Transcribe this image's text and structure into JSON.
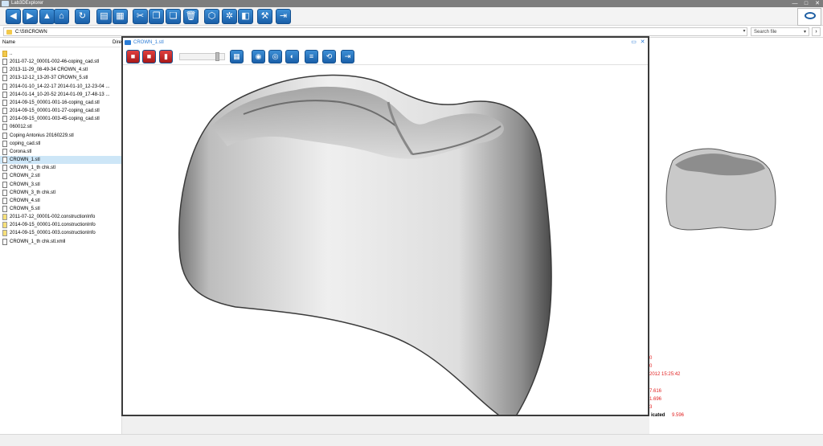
{
  "app": {
    "title": "Lab3DExplorer"
  },
  "window_controls": [
    "—",
    "□",
    "✕"
  ],
  "toolbar": {
    "buttons": [
      {
        "name": "back-button",
        "glyph": "◀"
      },
      {
        "name": "forward-button",
        "glyph": "▶"
      },
      {
        "name": "up-button",
        "glyph": "▲"
      },
      {
        "name": "home-button",
        "glyph": "⌂"
      },
      {
        "name": "refresh-button",
        "glyph": "↻"
      },
      {
        "name": "view-details-button",
        "glyph": "▤"
      },
      {
        "name": "view-grid-button",
        "glyph": "▦"
      },
      {
        "name": "cut-button",
        "glyph": "✂"
      },
      {
        "name": "copy-button",
        "glyph": "❐"
      },
      {
        "name": "paste-button",
        "glyph": "❏"
      },
      {
        "name": "delete-button",
        "glyph": "🗑"
      },
      {
        "name": "3d-view-button",
        "glyph": "⬡"
      },
      {
        "name": "tools-button",
        "glyph": "✲"
      },
      {
        "name": "cube-button",
        "glyph": "◧"
      },
      {
        "name": "settings-button",
        "glyph": "⚒"
      },
      {
        "name": "exit-button",
        "glyph": "⇥"
      }
    ]
  },
  "address": {
    "path": "C:\\Stl\\CROWN",
    "dropdown": "▾"
  },
  "search": {
    "placeholder": "Search file",
    "dropdown": "▾",
    "button": "›"
  },
  "filepanel": {
    "col_name": "Name",
    "col_dir": "Dire",
    "files": [
      {
        "name": "..",
        "type": "folder"
      },
      {
        "name": "2011-07-12_00001-002-46-coping_cad.stl",
        "type": "stl"
      },
      {
        "name": "2013-11-29_08-49-34 CROWN_4.stl",
        "type": "stl"
      },
      {
        "name": "2013-12-12_13-20-37 CROWN_5.stl",
        "type": "stl"
      },
      {
        "name": "2014-01-10_14-22-17 2014-01-10_12-23-04 ...",
        "type": "stl"
      },
      {
        "name": "2014-01-14_10-20-52 2014-01-09_17-48-13 ...",
        "type": "stl"
      },
      {
        "name": "2014-09-15_00001-001-16-coping_cad.stl",
        "type": "stl"
      },
      {
        "name": "2014-09-15_00001-001-27-coping_cad.stl",
        "type": "stl"
      },
      {
        "name": "2014-09-15_00001-003-45-coping_cad.stl",
        "type": "stl"
      },
      {
        "name": "060012.stl",
        "type": "stl"
      },
      {
        "name": "Coping Antonius 20160229.stl",
        "type": "stl"
      },
      {
        "name": "coping_cad.stl",
        "type": "stl"
      },
      {
        "name": "Corona.stl",
        "type": "stl"
      },
      {
        "name": "CROWN_1.stl",
        "type": "stl",
        "selected": true
      },
      {
        "name": "CROWN_1_th chk.stl",
        "type": "stl"
      },
      {
        "name": "CROWN_2.stl",
        "type": "stl"
      },
      {
        "name": "CROWN_3.stl",
        "type": "stl"
      },
      {
        "name": "CROWN_3_th chk.stl",
        "type": "stl"
      },
      {
        "name": "CROWN_4.stl",
        "type": "stl"
      },
      {
        "name": "CROWN_5.stl",
        "type": "stl"
      },
      {
        "name": "2011-07-12_00001-002.constructionInfo",
        "type": "info"
      },
      {
        "name": "2014-09-15_00001-001.constructionInfo",
        "type": "info"
      },
      {
        "name": "2014-09-15_00001-003.constructionInfo",
        "type": "info"
      },
      {
        "name": "CROWN_1_th chk.stl.xmll",
        "type": "doc"
      }
    ]
  },
  "viewer": {
    "title": "CROWN_1.stl",
    "controls": [
      "▭",
      "✕"
    ],
    "slider_value": 0.85,
    "toolbar": [
      {
        "name": "color-red-button",
        "glyph": "■",
        "red": true
      },
      {
        "name": "color-dark-button",
        "glyph": "■",
        "red": true
      },
      {
        "name": "color-side-button",
        "glyph": "▮",
        "red": true
      },
      {
        "name": "grid-button",
        "glyph": "▦"
      },
      {
        "name": "top-view-button",
        "glyph": "◉"
      },
      {
        "name": "front-view-button",
        "glyph": "◎"
      },
      {
        "name": "side-view-button",
        "glyph": "◐"
      },
      {
        "name": "layers-button",
        "glyph": "≡"
      },
      {
        "name": "rotate-button",
        "glyph": "⟲"
      },
      {
        "name": "close-viewer-button",
        "glyph": "⇥"
      }
    ]
  },
  "properties": [
    {
      "value": "0"
    },
    {
      "value": "0"
    },
    {
      "value": "2012 15:25:42"
    },
    {
      "value": ""
    },
    {
      "value": "7.616"
    },
    {
      "value": "1.696"
    },
    {
      "value": "3"
    },
    {
      "label": "icated",
      "value": "9.596"
    }
  ],
  "colors": {
    "accent": "#2b7cd6",
    "toolbar_blue": "#1a5fa8",
    "selection": "#cde6f7",
    "property_text": "#e02020"
  }
}
